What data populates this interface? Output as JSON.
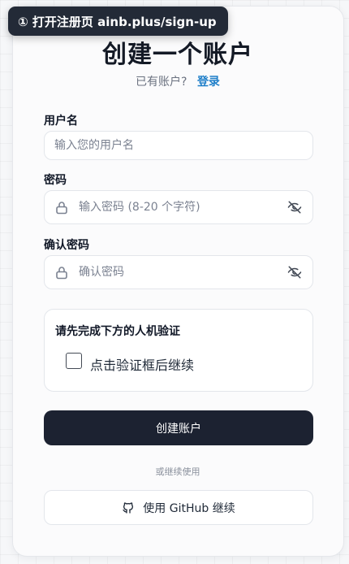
{
  "banner": {
    "text": "① 打开注册页 ainb.plus/sign-up"
  },
  "header": {
    "title": "创建一个账户",
    "have_account": "已有账户?",
    "login_link": "登录"
  },
  "form": {
    "username": {
      "label": "用户名",
      "placeholder": "输入您的用户名"
    },
    "password": {
      "label": "密码",
      "placeholder": "输入密码 (8-20 个字符)"
    },
    "confirm": {
      "label": "确认密码",
      "placeholder": "确认密码"
    }
  },
  "captcha": {
    "title": "请先完成下方的人机验证",
    "checkbox_label": "点击验证框后继续"
  },
  "actions": {
    "submit": "创建账户",
    "or_continue": "或继续使用",
    "github": "使用 GitHub 继续"
  },
  "icons": {
    "lock": "lock-icon",
    "eye": "eye-off-icon",
    "github": "github-icon"
  }
}
